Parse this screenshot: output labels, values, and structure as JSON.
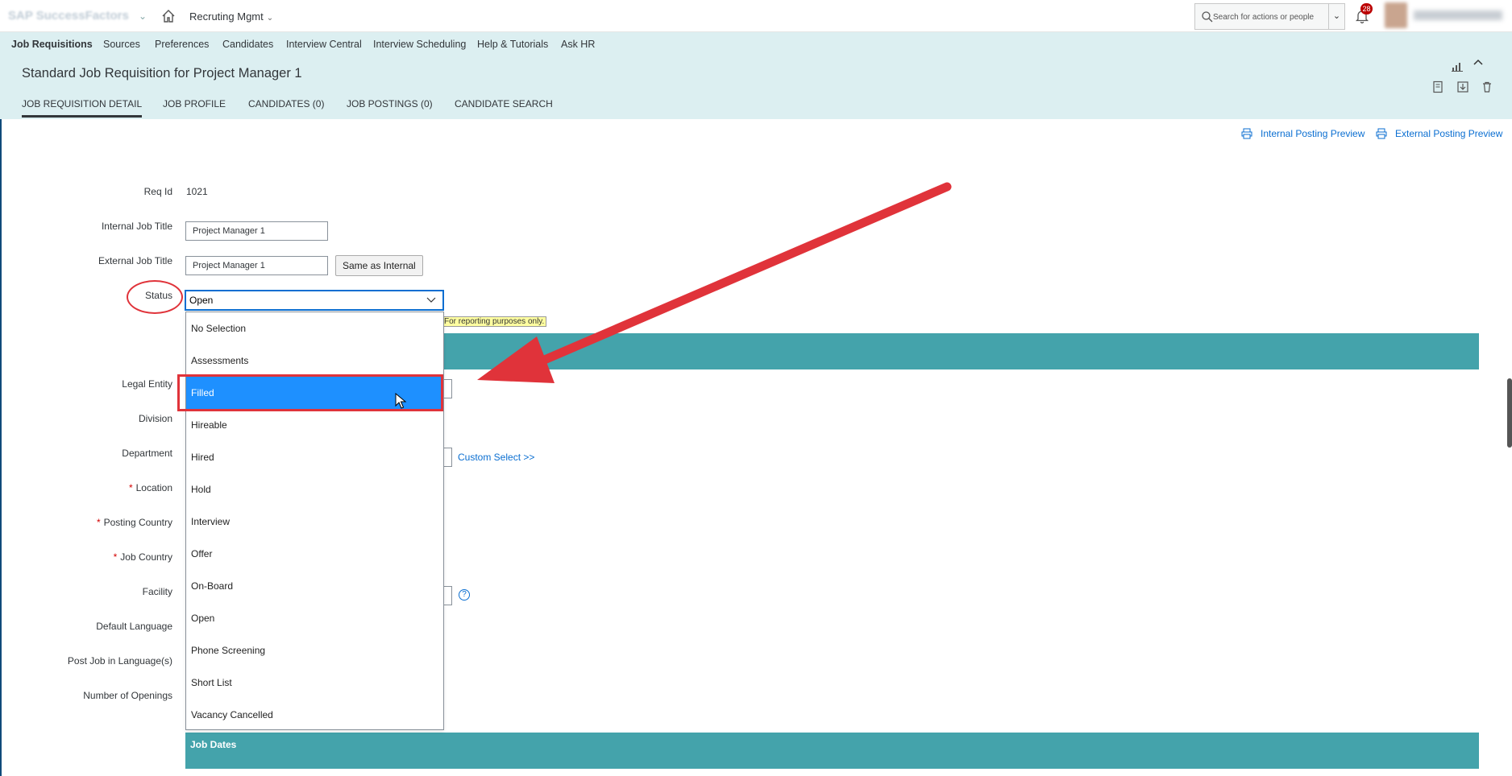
{
  "topbar": {
    "logo_text": "SAP SuccessFactors",
    "module_label": "Recruting Mgmt",
    "search_placeholder": "Search for actions or people",
    "notification_count": "28"
  },
  "menu": {
    "items": [
      "Job Requisitions",
      "Sources",
      "Preferences",
      "Candidates",
      "Interview Central",
      "Interview Scheduling",
      "Help & Tutorials",
      "Ask HR"
    ]
  },
  "header": {
    "title": "Standard Job Requisition for Project Manager 1",
    "tabs": [
      "JOB REQUISITION DETAIL",
      "JOB PROFILE",
      "CANDIDATES (0)",
      "JOB POSTINGS (0)",
      "CANDIDATE SEARCH"
    ]
  },
  "preview": {
    "internal": "Internal Posting Preview",
    "external": "External Posting Preview"
  },
  "form": {
    "req_id_label": "Req Id",
    "req_id_value": "1021",
    "internal_title_label": "Internal Job Title",
    "internal_title_value": "Project Manager 1",
    "external_title_label": "External Job Title",
    "external_title_value": "Project Manager 1",
    "same_as_internal": "Same as Internal",
    "status_label": "Status",
    "status_value": "Open",
    "reporting_hint": "For reporting purposes only.",
    "legal_entity_label": "Legal Entity",
    "division_label": "Division",
    "department_label": "Department",
    "custom_select": "Custom Select >>",
    "location_label": "Location",
    "posting_country_label": "Posting Country",
    "job_country_label": "Job Country",
    "facility_label": "Facility",
    "default_language_label": "Default Language",
    "post_job_language_label": "Post Job in Language(s)",
    "openings_label": "Number of Openings",
    "required_mark": "*",
    "help_mark": "?"
  },
  "status_options": [
    "No Selection",
    "Assessments",
    "Filled",
    "Hireable",
    "Hired",
    "Hold",
    "Interview",
    "Offer",
    "On-Board",
    "Open",
    "Phone Screening",
    "Short List",
    "Vacancy Cancelled"
  ],
  "highlighted_option": "Filled",
  "sections": {
    "job_dates": "Job Dates"
  },
  "colors": {
    "header_bg": "#dceff1",
    "section_band": "#44a3ab",
    "highlight": "#1e90ff",
    "annotation_red": "#e0333a",
    "link": "#0a6ed1"
  }
}
